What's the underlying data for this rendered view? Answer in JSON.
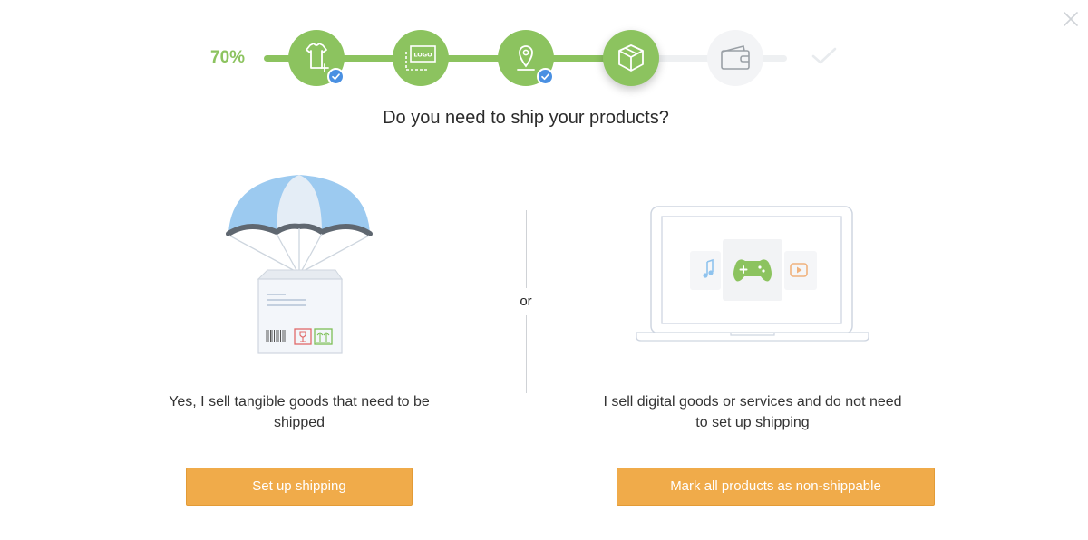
{
  "progress": {
    "percent_label": "70%",
    "percent_value": 0.7,
    "steps": [
      {
        "name": "product",
        "icon": "tshirt-add-icon",
        "state": "done",
        "checked": true
      },
      {
        "name": "logo",
        "icon": "logo-icon",
        "logo_text": "LOGO",
        "state": "done",
        "checked": false
      },
      {
        "name": "location",
        "icon": "location-pin-icon",
        "state": "done",
        "checked": true
      },
      {
        "name": "shipping",
        "icon": "box-icon",
        "state": "current",
        "checked": false
      },
      {
        "name": "payment",
        "icon": "wallet-icon",
        "state": "todo",
        "checked": false
      },
      {
        "name": "finish",
        "icon": "checkmark-icon",
        "state": "todo",
        "checked": false
      }
    ],
    "colors": {
      "done": "#8cc35f",
      "todo": "#f3f4f6",
      "badge": "#4a90e2"
    }
  },
  "question": "Do you need to ship your products?",
  "separator": "or",
  "options": {
    "physical": {
      "description": "Yes, I sell tangible goods that need to be shipped",
      "button_label": "Set up shipping",
      "illustration": "parachute-package-icon"
    },
    "digital": {
      "description": "I sell digital goods or services and do not need to set up shipping",
      "button_label": "Mark all products as non-shippable",
      "illustration": "laptop-digital-goods-icon"
    }
  },
  "colors": {
    "button": "#f0ab4a",
    "accent": "#8cc35f"
  },
  "close_icon": "close-icon"
}
